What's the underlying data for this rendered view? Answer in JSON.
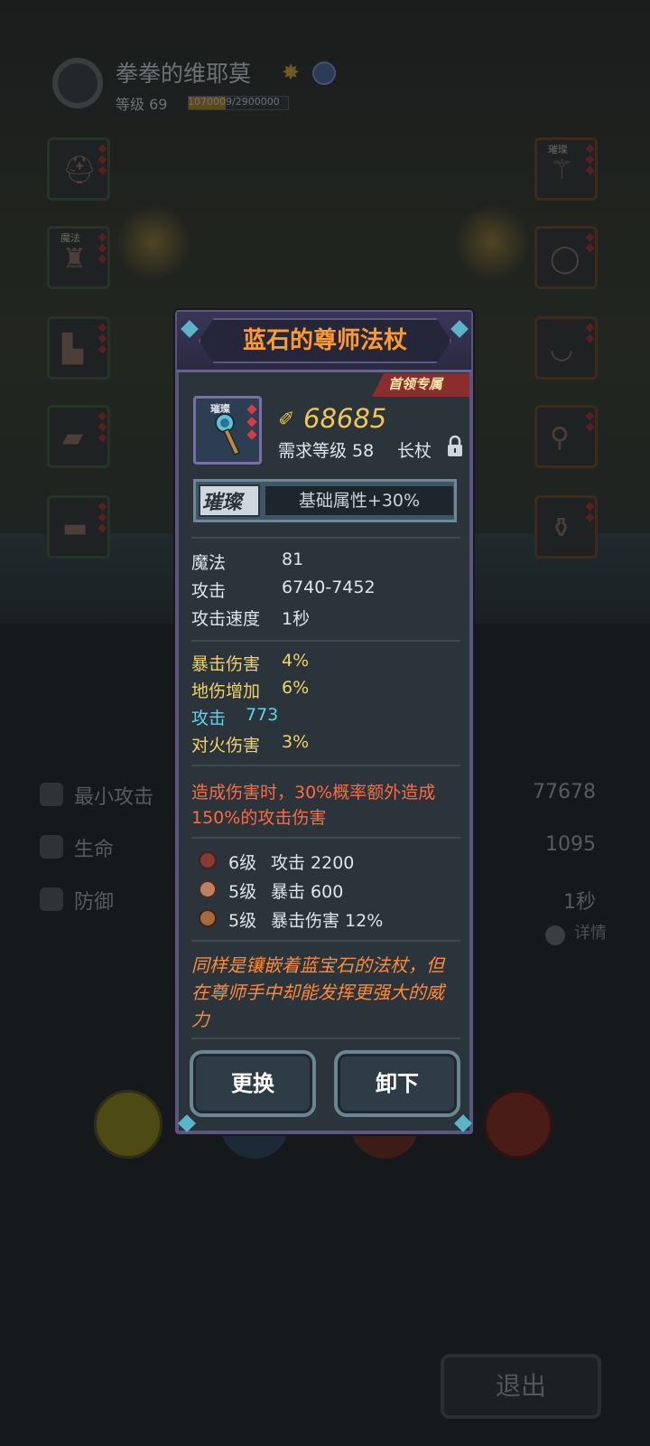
{
  "player": {
    "name": "拳拳的维耶莫",
    "level_label": "等级 69",
    "xp_text": "1070009/2900000",
    "xp_fraction": 0.369
  },
  "left_slots": [
    {
      "name": "helmet",
      "tag": ""
    },
    {
      "name": "armor",
      "tag": "魔法"
    },
    {
      "name": "boots",
      "tag": ""
    },
    {
      "name": "gloves",
      "tag": ""
    },
    {
      "name": "belt",
      "tag": ""
    }
  ],
  "right_slots": [
    {
      "name": "weapon",
      "tag": "璀璨"
    },
    {
      "name": "ring",
      "tag": ""
    },
    {
      "name": "necklace",
      "tag": ""
    },
    {
      "name": "amulet",
      "tag": ""
    },
    {
      "name": "charm",
      "tag": ""
    }
  ],
  "stats": [
    {
      "label": "最小攻击",
      "value": "77678"
    },
    {
      "label": "生命",
      "value": "1095"
    },
    {
      "label": "防御",
      "value": "1秒"
    }
  ],
  "detail_label": "详情",
  "exit_label": "退出",
  "item": {
    "title": "蓝石的尊师法杖",
    "boss_tag": "首领专属",
    "frame_tag": "璀璨",
    "power": "68685",
    "required_level": "需求等级 58",
    "weapon_type": "长杖",
    "quality_tag": "璀璨",
    "quality_bonus": "基础属性+30%",
    "base_attrs": [
      {
        "label": "魔法",
        "value": "81"
      },
      {
        "label": "攻击",
        "value": "6740-7452"
      },
      {
        "label": "攻击速度",
        "value": "1秒"
      }
    ],
    "extra_attrs": [
      {
        "label": "暴击伤害",
        "value": "4%"
      },
      {
        "label": "地伤增加",
        "value": "6%"
      },
      {
        "label": "攻击",
        "value": "773"
      },
      {
        "label": "对火伤害",
        "value": "3%"
      }
    ],
    "special_line1": "造成伤害时，30%概率额外造成",
    "special_line2": "150%的攻击伤害",
    "gems": [
      {
        "level": "6级",
        "effect": "攻击 2200"
      },
      {
        "level": "5级",
        "effect": "暴击 600"
      },
      {
        "level": "5级",
        "effect": "暴击伤害 12%"
      }
    ],
    "flavor_line1": "同样是镶嵌着蓝宝石的法杖，但",
    "flavor_line2": "在尊师手中却能发挥更强大的威",
    "flavor_line3": "力",
    "replace_label": "更换",
    "unequip_label": "卸下"
  },
  "colors": {
    "title": "#ff9a2e",
    "power": "#f0c656",
    "special": "#ff6a3e",
    "flavor": "#ff8a3a",
    "yellow_attr": "#f0d268",
    "cyan_attr": "#62d2e4"
  }
}
